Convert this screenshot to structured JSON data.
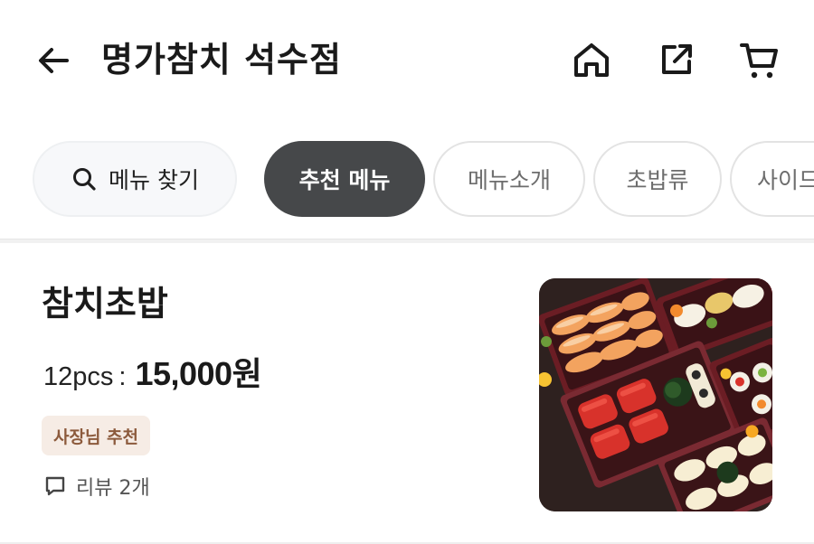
{
  "header": {
    "title": "명가참치 석수점",
    "icons": [
      "back-arrow-icon",
      "home-icon",
      "share-icon",
      "cart-icon"
    ]
  },
  "tabs": {
    "search_label": "메뉴 찾기",
    "items": [
      {
        "label": "추천 메뉴",
        "active": true
      },
      {
        "label": "메뉴소개",
        "active": false
      },
      {
        "label": "초밥류",
        "active": false
      },
      {
        "label": "사이드",
        "active": false
      }
    ]
  },
  "menu_item": {
    "name": "참치초밥",
    "quantity": "12pcs",
    "separator": ":",
    "price": "15,000원",
    "badge": "사장님 추천",
    "review": "리뷰 2개",
    "image": "sushi-platter-photo"
  },
  "colors": {
    "active_chip": "#46484a",
    "badge_bg": "#f6ece5",
    "badge_text": "#8c5a3c",
    "chip_border": "#e3e3e3"
  }
}
